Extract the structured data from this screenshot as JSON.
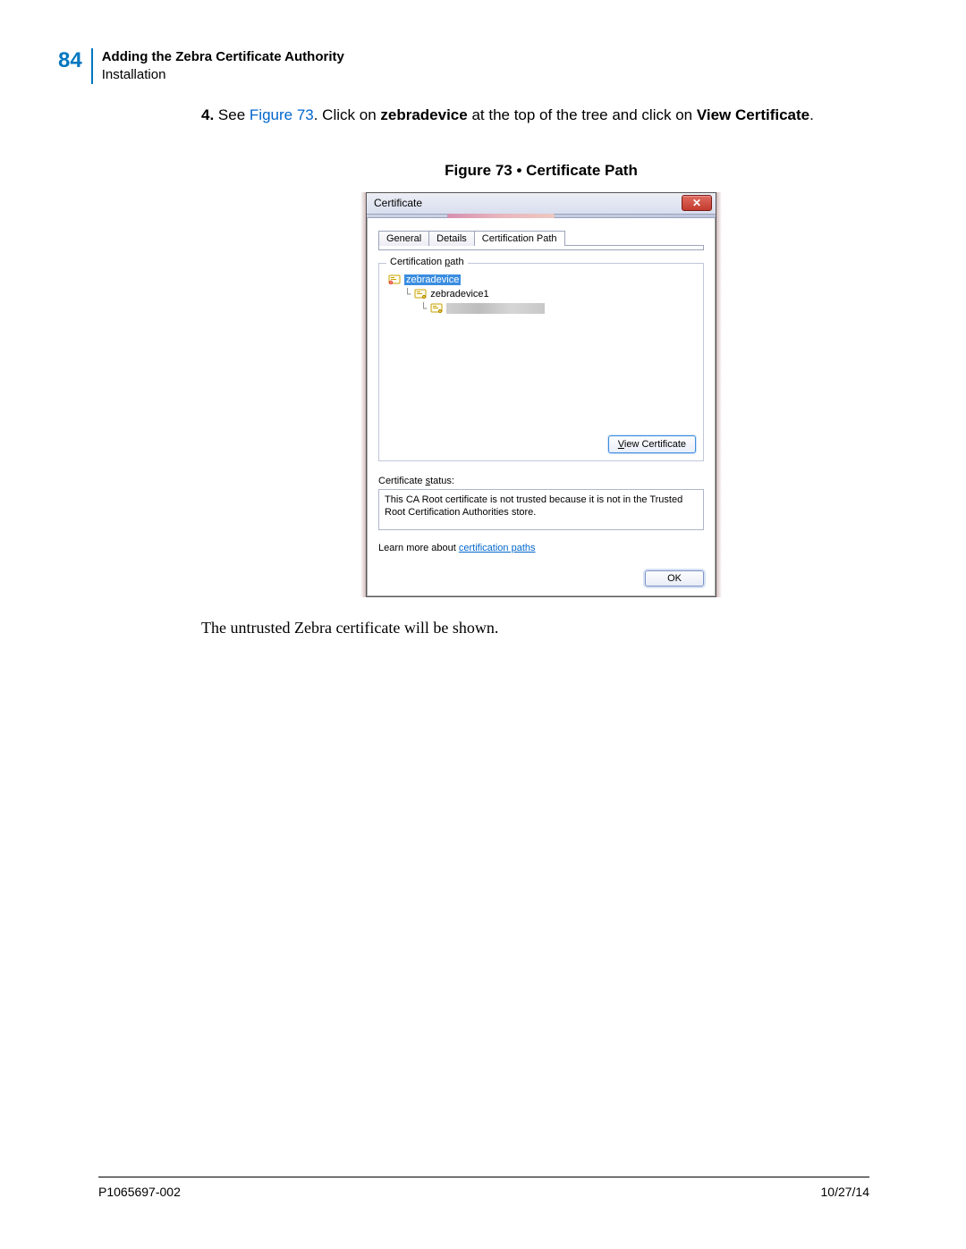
{
  "header": {
    "page_number": "84",
    "title": "Adding the Zebra Certificate Authority",
    "subtitle": "Installation"
  },
  "step": {
    "number": "4.",
    "text_see": "See ",
    "figure_ref": "Figure 73",
    "text_mid1": ". Click on ",
    "bold1": "zebradevice",
    "text_mid2": " at the top of the tree and click on ",
    "bold2": "View Certificate",
    "text_end": "."
  },
  "figure_caption": "Figure 73 • Certificate Path",
  "dialog": {
    "title": "Certificate",
    "close_glyph": "✕",
    "tabs": {
      "general": "General",
      "details": "Details",
      "certpath": "Certification Path"
    },
    "group_legend_prefix": "Certification ",
    "group_legend_under": "p",
    "group_legend_suffix": "ath",
    "tree": {
      "root": "zebradevice",
      "child1": "zebradevice1"
    },
    "view_btn_under": "V",
    "view_btn_rest": "iew Certificate",
    "status_label_prefix": "Certificate ",
    "status_label_under": "s",
    "status_label_suffix": "tatus:",
    "status_text": "This CA Root certificate is not trusted because it is not in the Trusted Root Certification Authorities store.",
    "learn_prefix": "Learn more about ",
    "learn_link": "certification paths",
    "ok": "OK"
  },
  "after_figure": "The untrusted Zebra certificate will be shown.",
  "footer": {
    "doc_id": "P1065697-002",
    "date": "10/27/14"
  }
}
